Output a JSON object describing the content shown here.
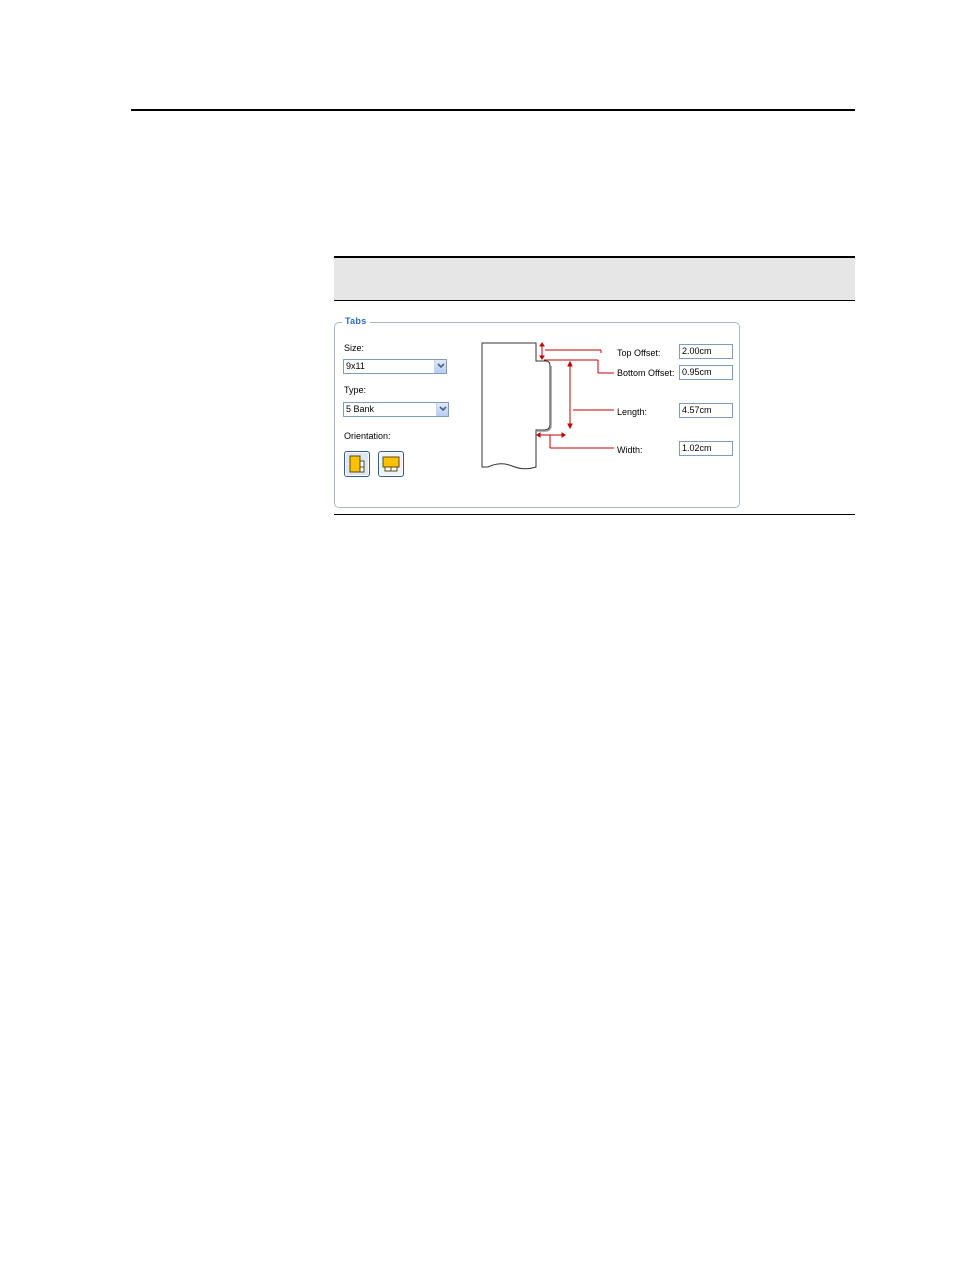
{
  "tabs_panel": {
    "legend": "Tabs",
    "size": {
      "label": "Size:",
      "value": "9x11"
    },
    "type": {
      "label": "Type:",
      "value": "5 Bank"
    },
    "orientation": {
      "label": "Orientation:",
      "options": [
        {
          "icon": "portrait-tab-icon",
          "selected": true
        },
        {
          "icon": "landscape-tab-icon",
          "selected": false
        }
      ]
    },
    "measurements": {
      "top_offset": {
        "label": "Top Offset:",
        "value": "2.00cm"
      },
      "bottom_offset": {
        "label": "Bottom Offset:",
        "value": "0.95cm"
      },
      "length": {
        "label": "Length:",
        "value": "4.57cm"
      },
      "width": {
        "label": "Width:",
        "value": "1.02cm"
      }
    }
  },
  "colors": {
    "legend": "#2b6cc4",
    "dimension_lines": "#c00000",
    "icon_fill": "#ffc000",
    "band": "#e6e6e6"
  }
}
